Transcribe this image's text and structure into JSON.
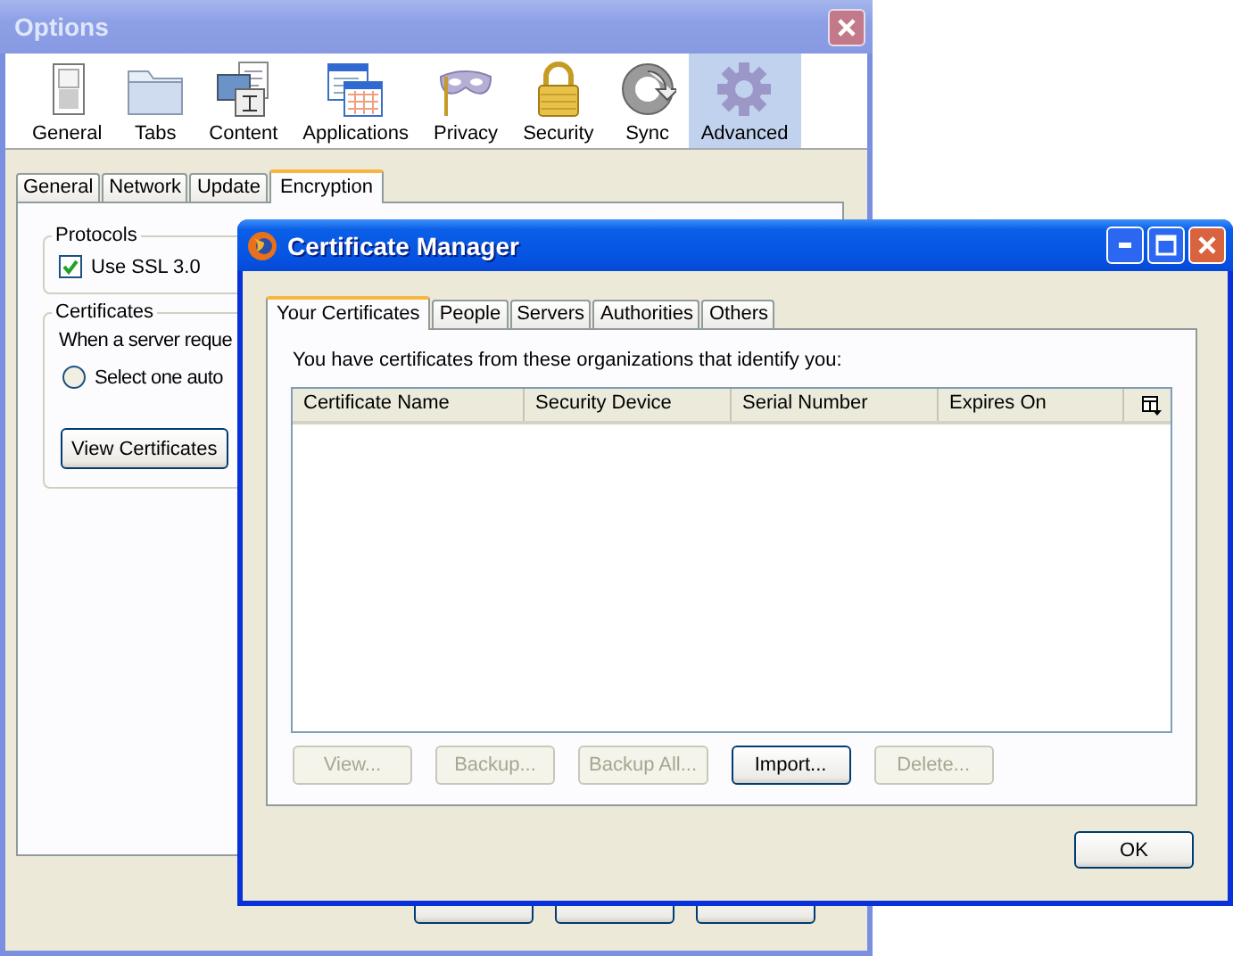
{
  "options_window": {
    "title": "Options",
    "toolbar": [
      {
        "label": "General",
        "selected": false
      },
      {
        "label": "Tabs",
        "selected": false
      },
      {
        "label": "Content",
        "selected": false
      },
      {
        "label": "Applications",
        "selected": false
      },
      {
        "label": "Privacy",
        "selected": false
      },
      {
        "label": "Security",
        "selected": false
      },
      {
        "label": "Sync",
        "selected": false
      },
      {
        "label": "Advanced",
        "selected": true
      }
    ],
    "tabs": [
      {
        "label": "General",
        "selected": false
      },
      {
        "label": "Network",
        "selected": false
      },
      {
        "label": "Update",
        "selected": false
      },
      {
        "label": "Encryption",
        "selected": true
      }
    ],
    "protocols": {
      "title": "Protocols",
      "checkbox": {
        "label": "Use SSL 3.0",
        "checked": true
      }
    },
    "certificates": {
      "title": "Certificates",
      "text": "When a server reque",
      "radio": {
        "label": "Select one auto",
        "selected": false
      },
      "button": "View Certificates"
    }
  },
  "certificate_manager": {
    "title": "Certificate Manager",
    "tabs": [
      {
        "label": "Your Certificates",
        "selected": true
      },
      {
        "label": "People",
        "selected": false
      },
      {
        "label": "Servers",
        "selected": false
      },
      {
        "label": "Authorities",
        "selected": false
      },
      {
        "label": "Others",
        "selected": false
      }
    ],
    "description": "You have certificates from these organizations that identify you:",
    "table": {
      "columns": [
        "Certificate Name",
        "Security Device",
        "Serial Number",
        "Expires On"
      ]
    },
    "buttons": [
      {
        "label": "View...",
        "disabled": true
      },
      {
        "label": "Backup...",
        "disabled": true
      },
      {
        "label": "Backup All...",
        "disabled": true
      },
      {
        "label": "Import...",
        "disabled": false
      },
      {
        "label": "Delete...",
        "disabled": true
      }
    ],
    "ok_button": "OK"
  }
}
